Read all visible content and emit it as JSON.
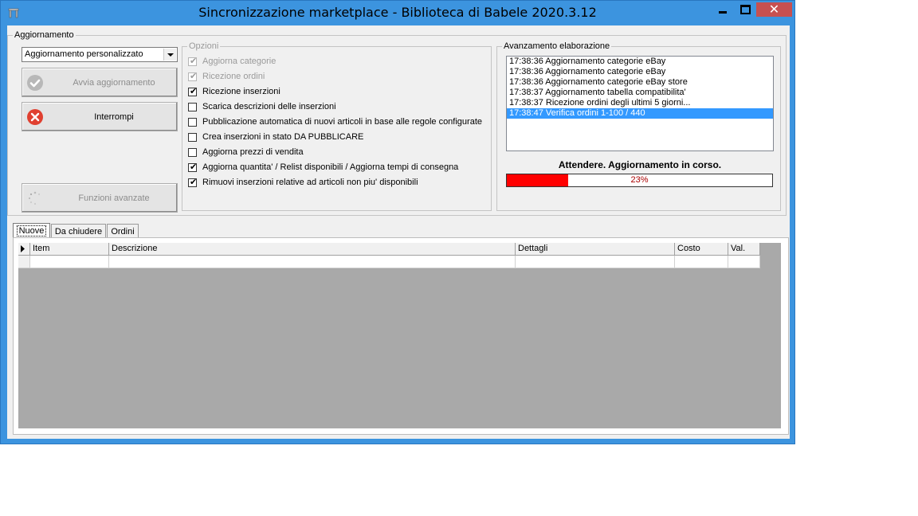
{
  "window": {
    "title": "Sincronizzazione marketplace - Biblioteca di Babele 2020.3.12",
    "buttons": {
      "minimize": "minimize",
      "maximize": "maximize",
      "close": "✕"
    }
  },
  "aggiornamento": {
    "legend": "Aggiornamento",
    "mode_value": "Aggiornamento personalizzato",
    "start_button": "Avvia aggiornamento",
    "stop_button": "Interrompi",
    "advanced_button": "Funzioni avanzate",
    "icons": {
      "start": "check-circle-icon",
      "stop": "close-circle-icon",
      "advanced": "busy-spinner-icon"
    }
  },
  "opzioni": {
    "legend": "Opzioni",
    "items": [
      {
        "label": "Aggiorna categorie",
        "checked": true,
        "enabled": false
      },
      {
        "label": "Ricezione ordini",
        "checked": true,
        "enabled": false
      },
      {
        "label": "Ricezione inserzioni",
        "checked": true,
        "enabled": true
      },
      {
        "label": "Scarica descrizioni delle inserzioni",
        "checked": false,
        "enabled": true
      },
      {
        "label": "Pubblicazione automatica di nuovi articoli in base alle regole configurate",
        "checked": false,
        "enabled": true
      },
      {
        "label": "Crea inserzioni in stato DA PUBBLICARE",
        "checked": false,
        "enabled": true
      },
      {
        "label": "Aggiorna prezzi di vendita",
        "checked": false,
        "enabled": true
      },
      {
        "label": "Aggiorna quantita' / Relist disponibili / Aggiorna tempi di consegna",
        "checked": true,
        "enabled": true
      },
      {
        "label": "Rimuovi inserzioni relative ad articoli non piu' disponibili",
        "checked": true,
        "enabled": true
      }
    ]
  },
  "avanzamento": {
    "legend": "Avanzamento elaborazione",
    "log": [
      "17:38:36 Aggiornamento categorie eBay",
      "17:38:36 Aggiornamento categorie eBay",
      "17:38:36 Aggiornamento categorie eBay store",
      "17:38:37 Aggiornamento tabella compatibilita'",
      "17:38:37 Ricezione ordini degli ultimi 5 giorni...",
      "17:38:47 Verifica ordini 1-100 / 440"
    ],
    "selected_index": 5,
    "status": "Attendere. Aggiornamento in corso.",
    "progress_percent": 23,
    "progress_label": "23%"
  },
  "tabs": [
    {
      "label": "Nuove",
      "active": true
    },
    {
      "label": "Da chiudere",
      "active": false
    },
    {
      "label": "Ordini",
      "active": false
    }
  ],
  "grid": {
    "columns": [
      "Item",
      "Descrizione",
      "Dettagli",
      "Costo",
      "Val."
    ],
    "row_indicator": "current-row-arrow-icon"
  },
  "colors": {
    "titlebar": "#3c94df",
    "close_button": "#c75050",
    "selection": "#3399ff",
    "progress_fill": "#ff0000"
  }
}
